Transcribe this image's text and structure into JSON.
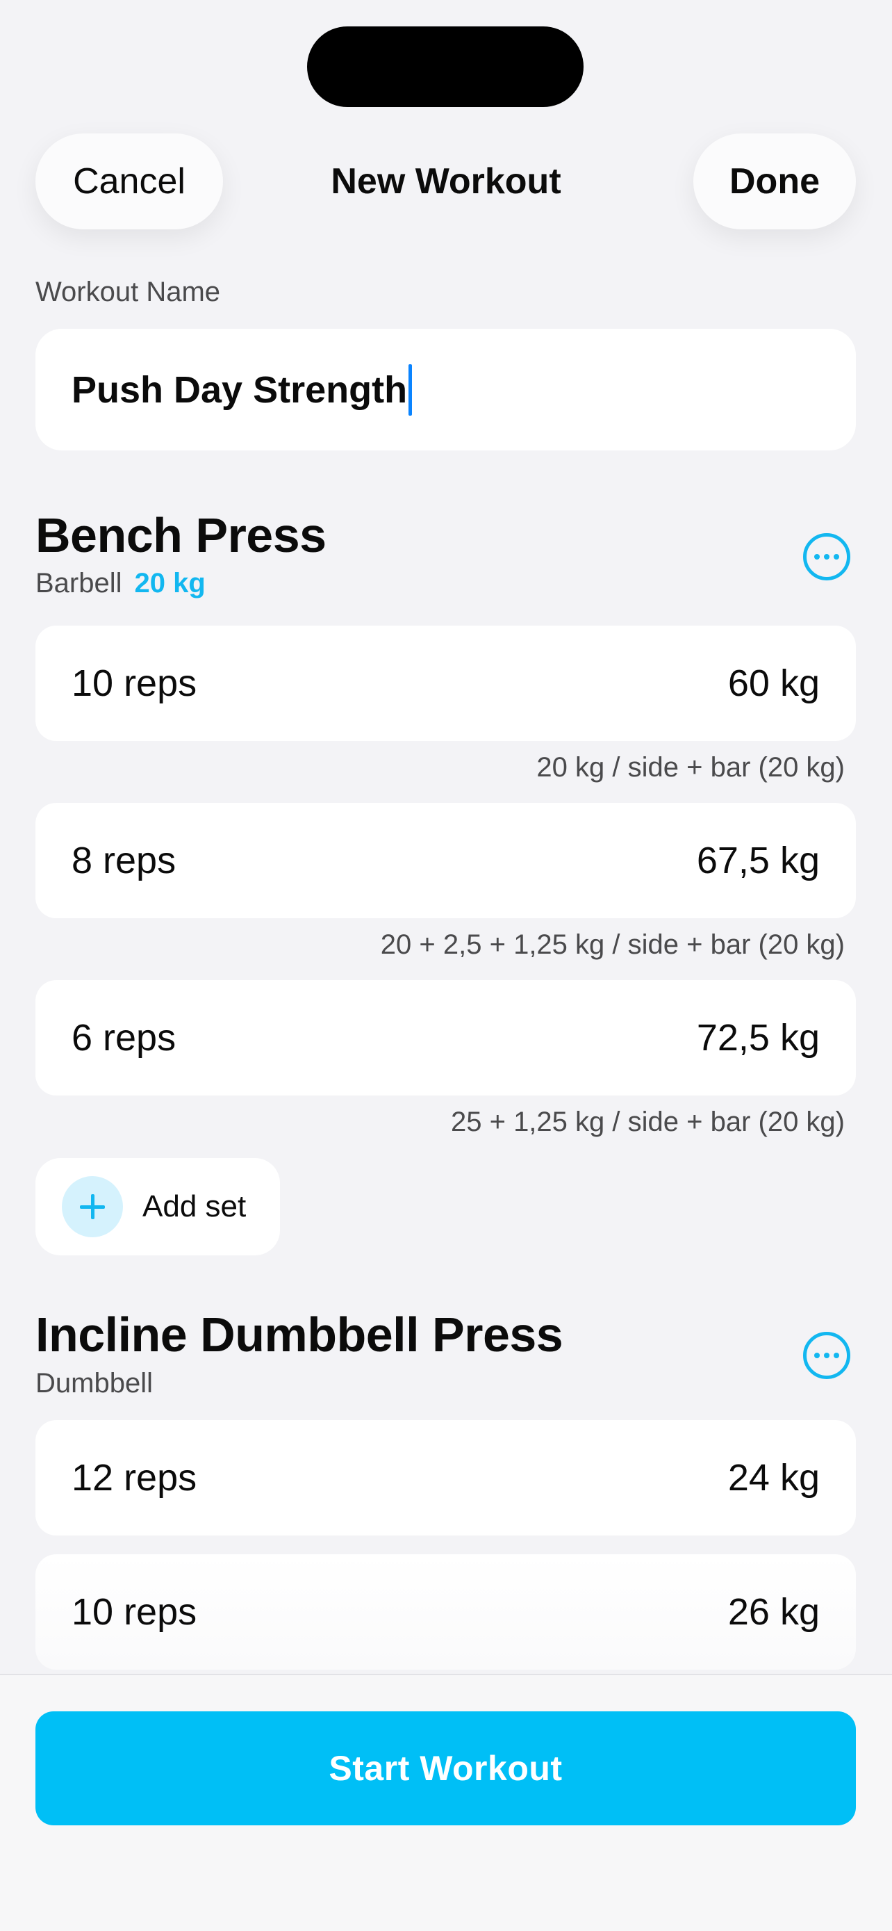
{
  "nav": {
    "cancel_label": "Cancel",
    "title": "New Workout",
    "done_label": "Done"
  },
  "workout_name": {
    "label": "Workout Name",
    "value": "Push Day Strength"
  },
  "exercises": [
    {
      "title": "Bench Press",
      "equipment": "Barbell",
      "bar_weight": "20 kg",
      "sets": [
        {
          "reps": "10 reps",
          "weight": "60 kg",
          "plates": "20 kg / side + bar (20 kg)"
        },
        {
          "reps": "8 reps",
          "weight": "67,5 kg",
          "plates": "20 + 2,5 + 1,25 kg / side + bar (20 kg)"
        },
        {
          "reps": "6 reps",
          "weight": "72,5 kg",
          "plates": "25 + 1,25 kg / side + bar (20 kg)"
        }
      ],
      "add_set_label": "Add set"
    },
    {
      "title": "Incline Dumbbell Press",
      "equipment": "Dumbbell",
      "sets": [
        {
          "reps": "12 reps",
          "weight": "24 kg"
        },
        {
          "reps": "10 reps",
          "weight": "26 kg"
        }
      ]
    }
  ],
  "footer": {
    "start_label": "Start Workout"
  },
  "colors": {
    "accent": "#12B7F0",
    "primary_button": "#00BFF6",
    "caret": "#0A84FF",
    "background": "#F3F3F6"
  },
  "icons": {
    "more": "ellipsis-circle-icon",
    "add": "plus-circle-icon"
  }
}
